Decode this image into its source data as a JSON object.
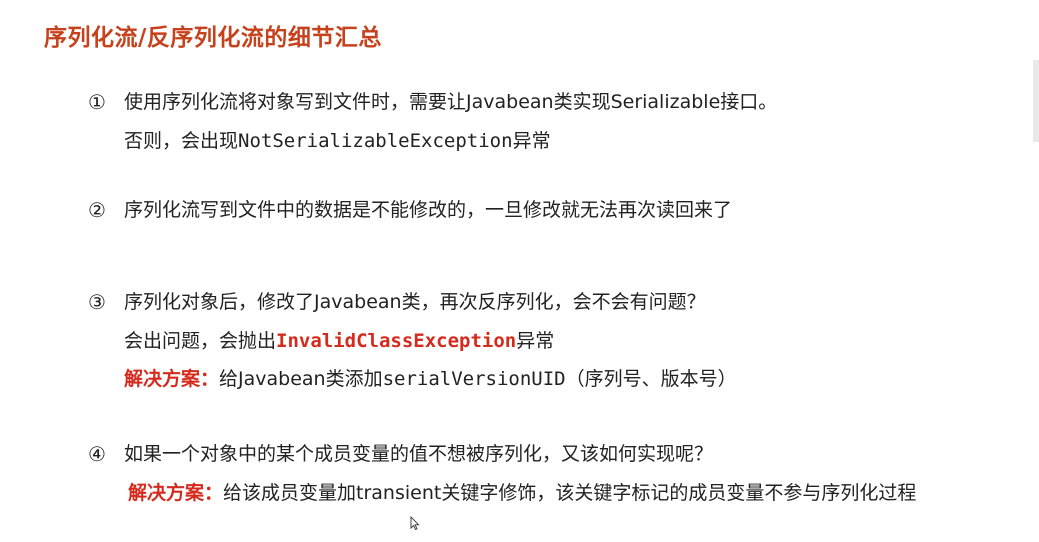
{
  "title": "序列化流/反序列化流的细节汇总",
  "items": [
    {
      "number": "①",
      "text": "使用序列化流将对象写到文件时，需要让Javabean类实现Serializable接口。",
      "sub_prefix": "否则，会出现",
      "sub_code": "NotSerializableException",
      "sub_suffix": "异常"
    },
    {
      "number": "②",
      "text": "序列化流写到文件中的数据是不能修改的，一旦修改就无法再次读回来了"
    },
    {
      "number": "③",
      "text": "序列化对象后，修改了Javabean类，再次反序列化，会不会有问题？",
      "sub_prefix": "会出问题，会抛出",
      "sub_code": "InvalidClassException",
      "sub_suffix": "异常",
      "solution_label": "解决方案：",
      "solution_prefix": "给Javabean类添加",
      "solution_code": "serialVersionUID",
      "solution_suffix": "（序列号、版本号）"
    },
    {
      "number": "④",
      "text": "如果一个对象中的某个成员变量的值不想被序列化，又该如何实现呢？",
      "solution_label": "解决方案：",
      "solution_text": "给该成员变量加transient关键字修饰，该关键字标记的成员变量不参与序列化过程"
    }
  ],
  "colors": {
    "title": "#c6421c",
    "highlight": "#d52b1e",
    "text": "#222222"
  }
}
